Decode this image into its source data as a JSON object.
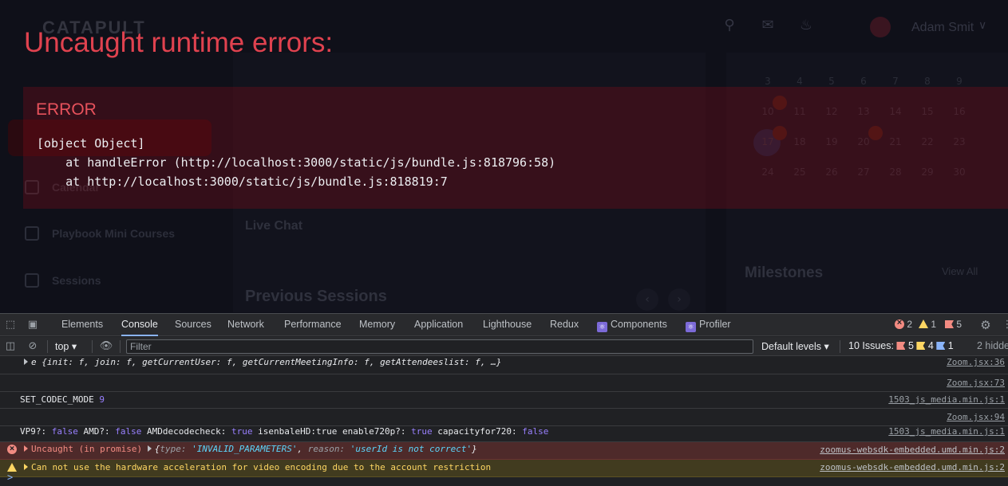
{
  "app": {
    "brand": "CATAPULT",
    "user_name": "Adam Smit",
    "sidebar": [
      {
        "label": "Calendar"
      },
      {
        "label": "Playbook Mini Courses"
      },
      {
        "label": "Sessions"
      }
    ],
    "sections": {
      "live_chat": "Live Chat",
      "previous_sessions": "Previous Sessions",
      "milestones": "Milestones",
      "view_all": "View All"
    },
    "calendar_rows": [
      [
        "3",
        "4",
        "5",
        "6",
        "7",
        "8",
        "9"
      ],
      [
        "10",
        "11",
        "12",
        "13",
        "14",
        "15",
        "16"
      ],
      [
        "17",
        "18",
        "19",
        "20",
        "21",
        "22",
        "23"
      ],
      [
        "24",
        "25",
        "26",
        "27",
        "28",
        "29",
        "30"
      ]
    ]
  },
  "overlay": {
    "title": "Uncaught runtime errors:",
    "error_label": "ERROR",
    "stack": [
      "[object Object]",
      "    at handleError (http://localhost:3000/static/js/bundle.js:818796:58)",
      "    at http://localhost:3000/static/js/bundle.js:818819:7"
    ]
  },
  "devtools": {
    "tabs": [
      "Elements",
      "Console",
      "Sources",
      "Network",
      "Performance",
      "Memory",
      "Application",
      "Lighthouse",
      "Redux",
      "Components",
      "Profiler"
    ],
    "active_tab": "Console",
    "counts": {
      "errors": "2",
      "warnings": "1",
      "issues": "5"
    },
    "toolbar": {
      "context": "top",
      "filter_placeholder": "Filter",
      "levels": "Default levels",
      "issues_label": "10 Issues:",
      "issues_err": "5",
      "issues_warn": "4",
      "issues_info": "1",
      "hidden": "2 hidden"
    },
    "console": {
      "line1": {
        "prefix": "e ",
        "text": "{init: f, join: f, getCurrentUser: f, getCurrentMeetingInfo: f, getAttendeeslist: f, …}",
        "source": "Zoom.jsx:36"
      },
      "line2": {
        "source": "Zoom.jsx:73"
      },
      "line3": {
        "text": "SET_CODEC_MODE",
        "value": "9",
        "source": "1503_js_media.min.js:1"
      },
      "line4": {
        "source": "Zoom.jsx:94"
      },
      "line5": {
        "a": "VP9?:",
        "b": "false",
        "c": "AMD?:",
        "d": "false",
        "e": "AMDdecodecheck:",
        "f": "true",
        "g": "isenbaleHD:true enable720p?:",
        "h": "true",
        "i": "capacityfor720:",
        "j": "false",
        "source": "1503_js_media.min.js:1"
      },
      "line6": {
        "text": "Uncaught (in promise)",
        "obj_open": "{",
        "k1": "type:",
        "v1": "'INVALID_PARAMETERS'",
        "sep": ",",
        "k2": "reason:",
        "v2": "'userId is not correct'",
        "obj_close": "}",
        "source": "zoomus-websdk-embedded.umd.min.js:2"
      },
      "line7": {
        "text": "Can not use the hardware acceleration for video encoding due to the account restriction",
        "source": "zoomus-websdk-embedded.umd.min.js:2"
      },
      "prompt": ">"
    }
  }
}
